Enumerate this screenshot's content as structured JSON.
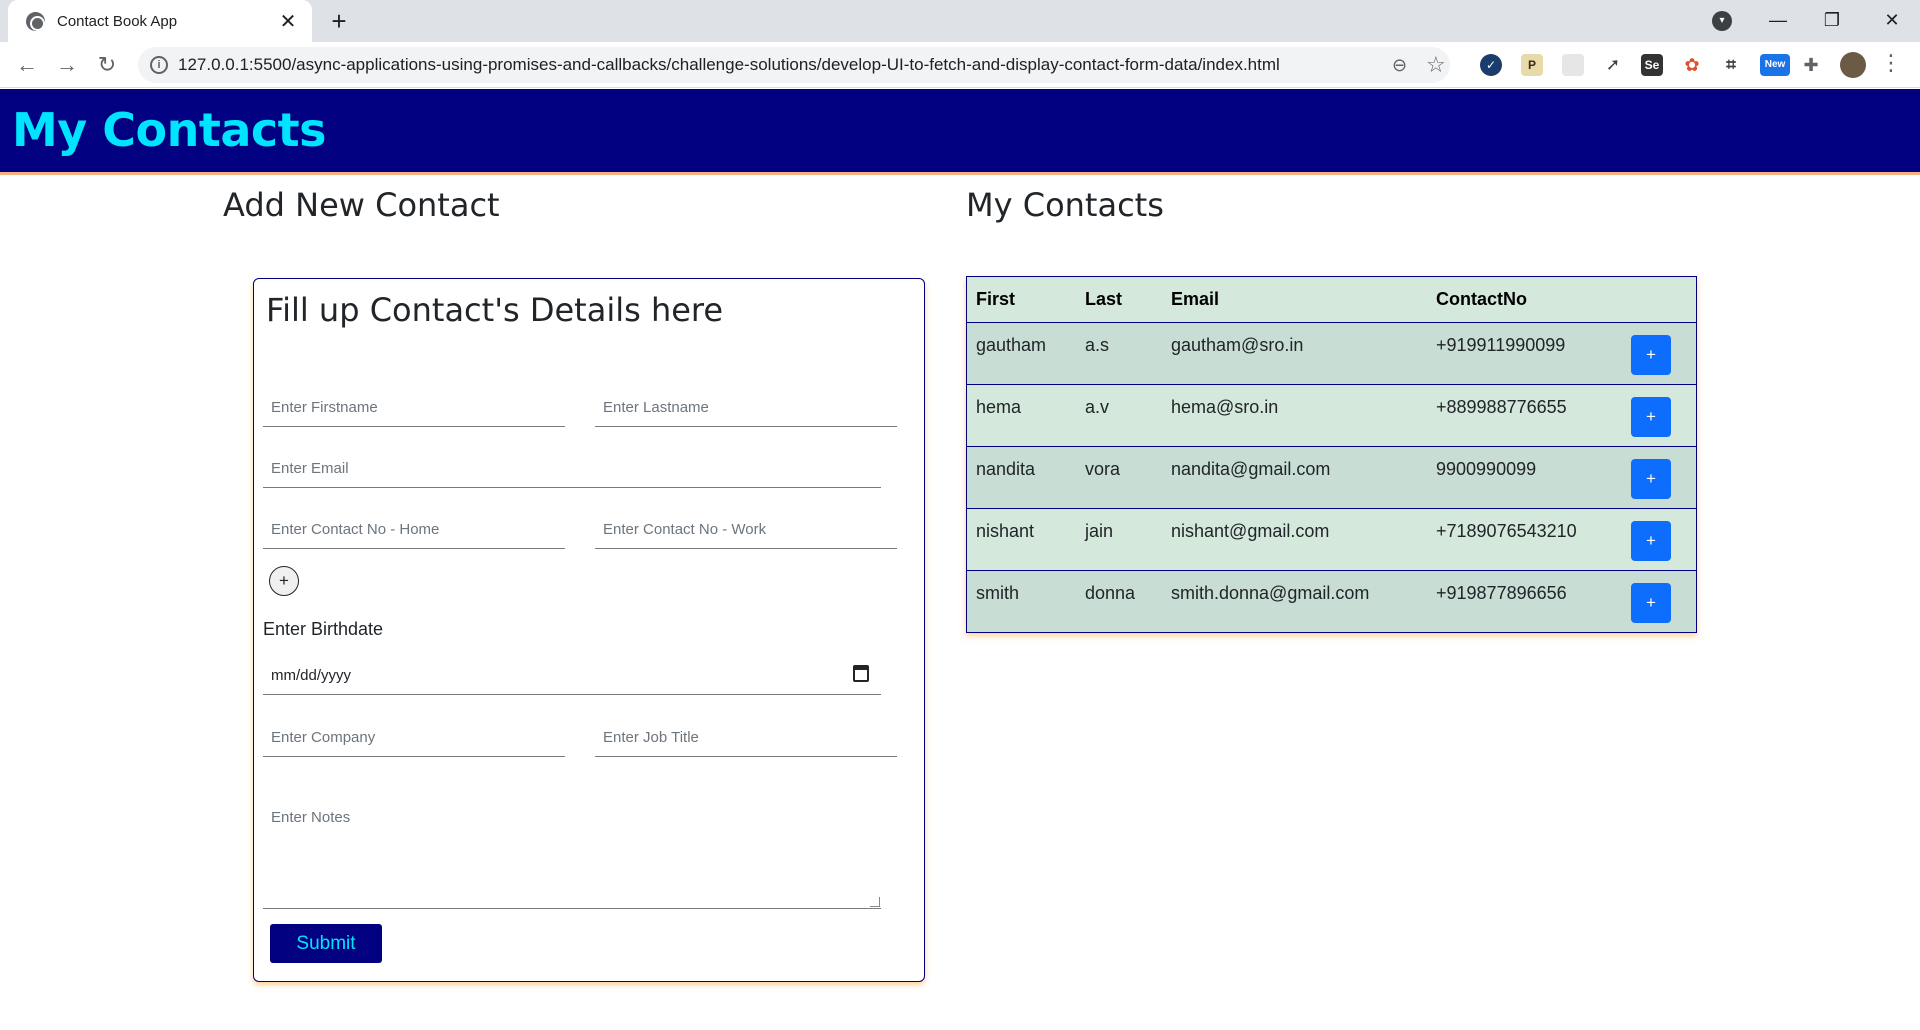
{
  "browser": {
    "tab_title": "Contact Book App",
    "url": "127.0.0.1:5500/async-applications-using-promises-and-callbacks/challenge-solutions/develop-UI-to-fetch-and-display-contact-form-data/index.html",
    "extension_badge": "New"
  },
  "navbar": {
    "brand": "My Contacts"
  },
  "form_section": {
    "title": "Add New Contact",
    "card_title": "Fill up Contact's Details here",
    "placeholders": {
      "firstname": "Enter Firstname",
      "lastname": "Enter Lastname",
      "email": "Enter Email",
      "contact_home": "Enter Contact No - Home",
      "contact_work": "Enter Contact No - Work",
      "company": "Enter Company",
      "job_title": "Enter Job Title",
      "notes": "Enter Notes"
    },
    "add_phone_label": "+",
    "birthdate_label": "Enter Birthdate",
    "birthdate_value": "mm/dd/yyyy",
    "submit_label": "Submit"
  },
  "contacts_section": {
    "title": "My Contacts",
    "columns": [
      "First",
      "Last",
      "Email",
      "ContactNo"
    ],
    "rows": [
      {
        "first": "gautham",
        "last": "a.s",
        "email": "gautham@sro.in",
        "contact": "+919911990099",
        "action": "+"
      },
      {
        "first": "hema",
        "last": "a.v",
        "email": "hema@sro.in",
        "contact": "+889988776655",
        "action": "+"
      },
      {
        "first": "nandita",
        "last": "vora",
        "email": "nandita@gmail.com",
        "contact": "9900990099",
        "action": "+"
      },
      {
        "first": "nishant",
        "last": "jain",
        "email": "nishant@gmail.com",
        "contact": "+7189076543210",
        "action": "+"
      },
      {
        "first": "smith",
        "last": "donna",
        "email": "smith.donna@gmail.com",
        "contact": "+919877896656",
        "action": "+"
      }
    ]
  },
  "colors": {
    "navbar_bg": "#000080",
    "brand_text": "#00e5ff",
    "row_button": "#0d6efd"
  }
}
